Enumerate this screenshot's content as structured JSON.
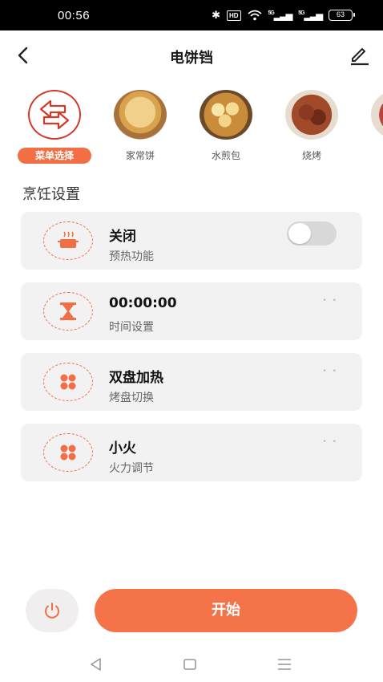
{
  "status_bar": {
    "time": "00:56",
    "bluetooth": "✱",
    "hd": "HD",
    "signal_1": "5G",
    "signal_2": "5G",
    "battery": "63"
  },
  "header": {
    "title": "电饼铛"
  },
  "menu": {
    "items": [
      {
        "label": "菜单选择",
        "icon": "swap-arrows-icon",
        "active": true
      },
      {
        "label": "家常饼",
        "icon": "pancake-photo"
      },
      {
        "label": "水煎包",
        "icon": "fried-bun-photo"
      },
      {
        "label": "烧烤",
        "icon": "bbq-photo"
      }
    ]
  },
  "section_title": "烹饪设置",
  "settings": [
    {
      "title": "关闭",
      "subtitle": "预热功能",
      "icon": "pot-icon",
      "control": "toggle",
      "toggle_on": false
    },
    {
      "title": "00:00:00",
      "subtitle": "时间设置",
      "icon": "hourglass-icon",
      "control": "more"
    },
    {
      "title": "双盘加热",
      "subtitle": "烤盘切换",
      "icon": "four-dots-icon",
      "control": "more"
    },
    {
      "title": "小火",
      "subtitle": "火力调节",
      "icon": "four-dots-icon",
      "control": "more"
    }
  ],
  "more_dots": "• •",
  "footer": {
    "start_label": "开始"
  },
  "colors": {
    "accent": "#f26f45",
    "button": "#f57348",
    "card_bg": "#f2f2f2"
  }
}
